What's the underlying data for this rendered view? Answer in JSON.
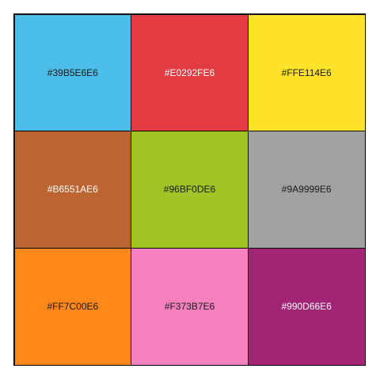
{
  "chart_data": {
    "type": "heatmap",
    "title": "",
    "rows": 3,
    "cols": 3,
    "cells": [
      {
        "label": "#39B5E6E6",
        "color": "#39B5E6",
        "text_color": "#000000"
      },
      {
        "label": "#E0292FE6",
        "color": "#E0292F",
        "text_color": "#ffffff"
      },
      {
        "label": "#FFE114E6",
        "color": "#FFE114",
        "text_color": "#000000"
      },
      {
        "label": "#B6551AE6",
        "color": "#B6551A",
        "text_color": "#ffffff"
      },
      {
        "label": "#96BF0DE6",
        "color": "#96BF0D",
        "text_color": "#000000"
      },
      {
        "label": "#9A9999E6",
        "color": "#9A9999",
        "text_color": "#000000"
      },
      {
        "label": "#FF7C00E6",
        "color": "#FF7C00",
        "text_color": "#000000"
      },
      {
        "label": "#F373B7E6",
        "color": "#F373B7",
        "text_color": "#000000"
      },
      {
        "label": "#990D66E6",
        "color": "#990D66",
        "text_color": "#ffffff"
      }
    ]
  }
}
